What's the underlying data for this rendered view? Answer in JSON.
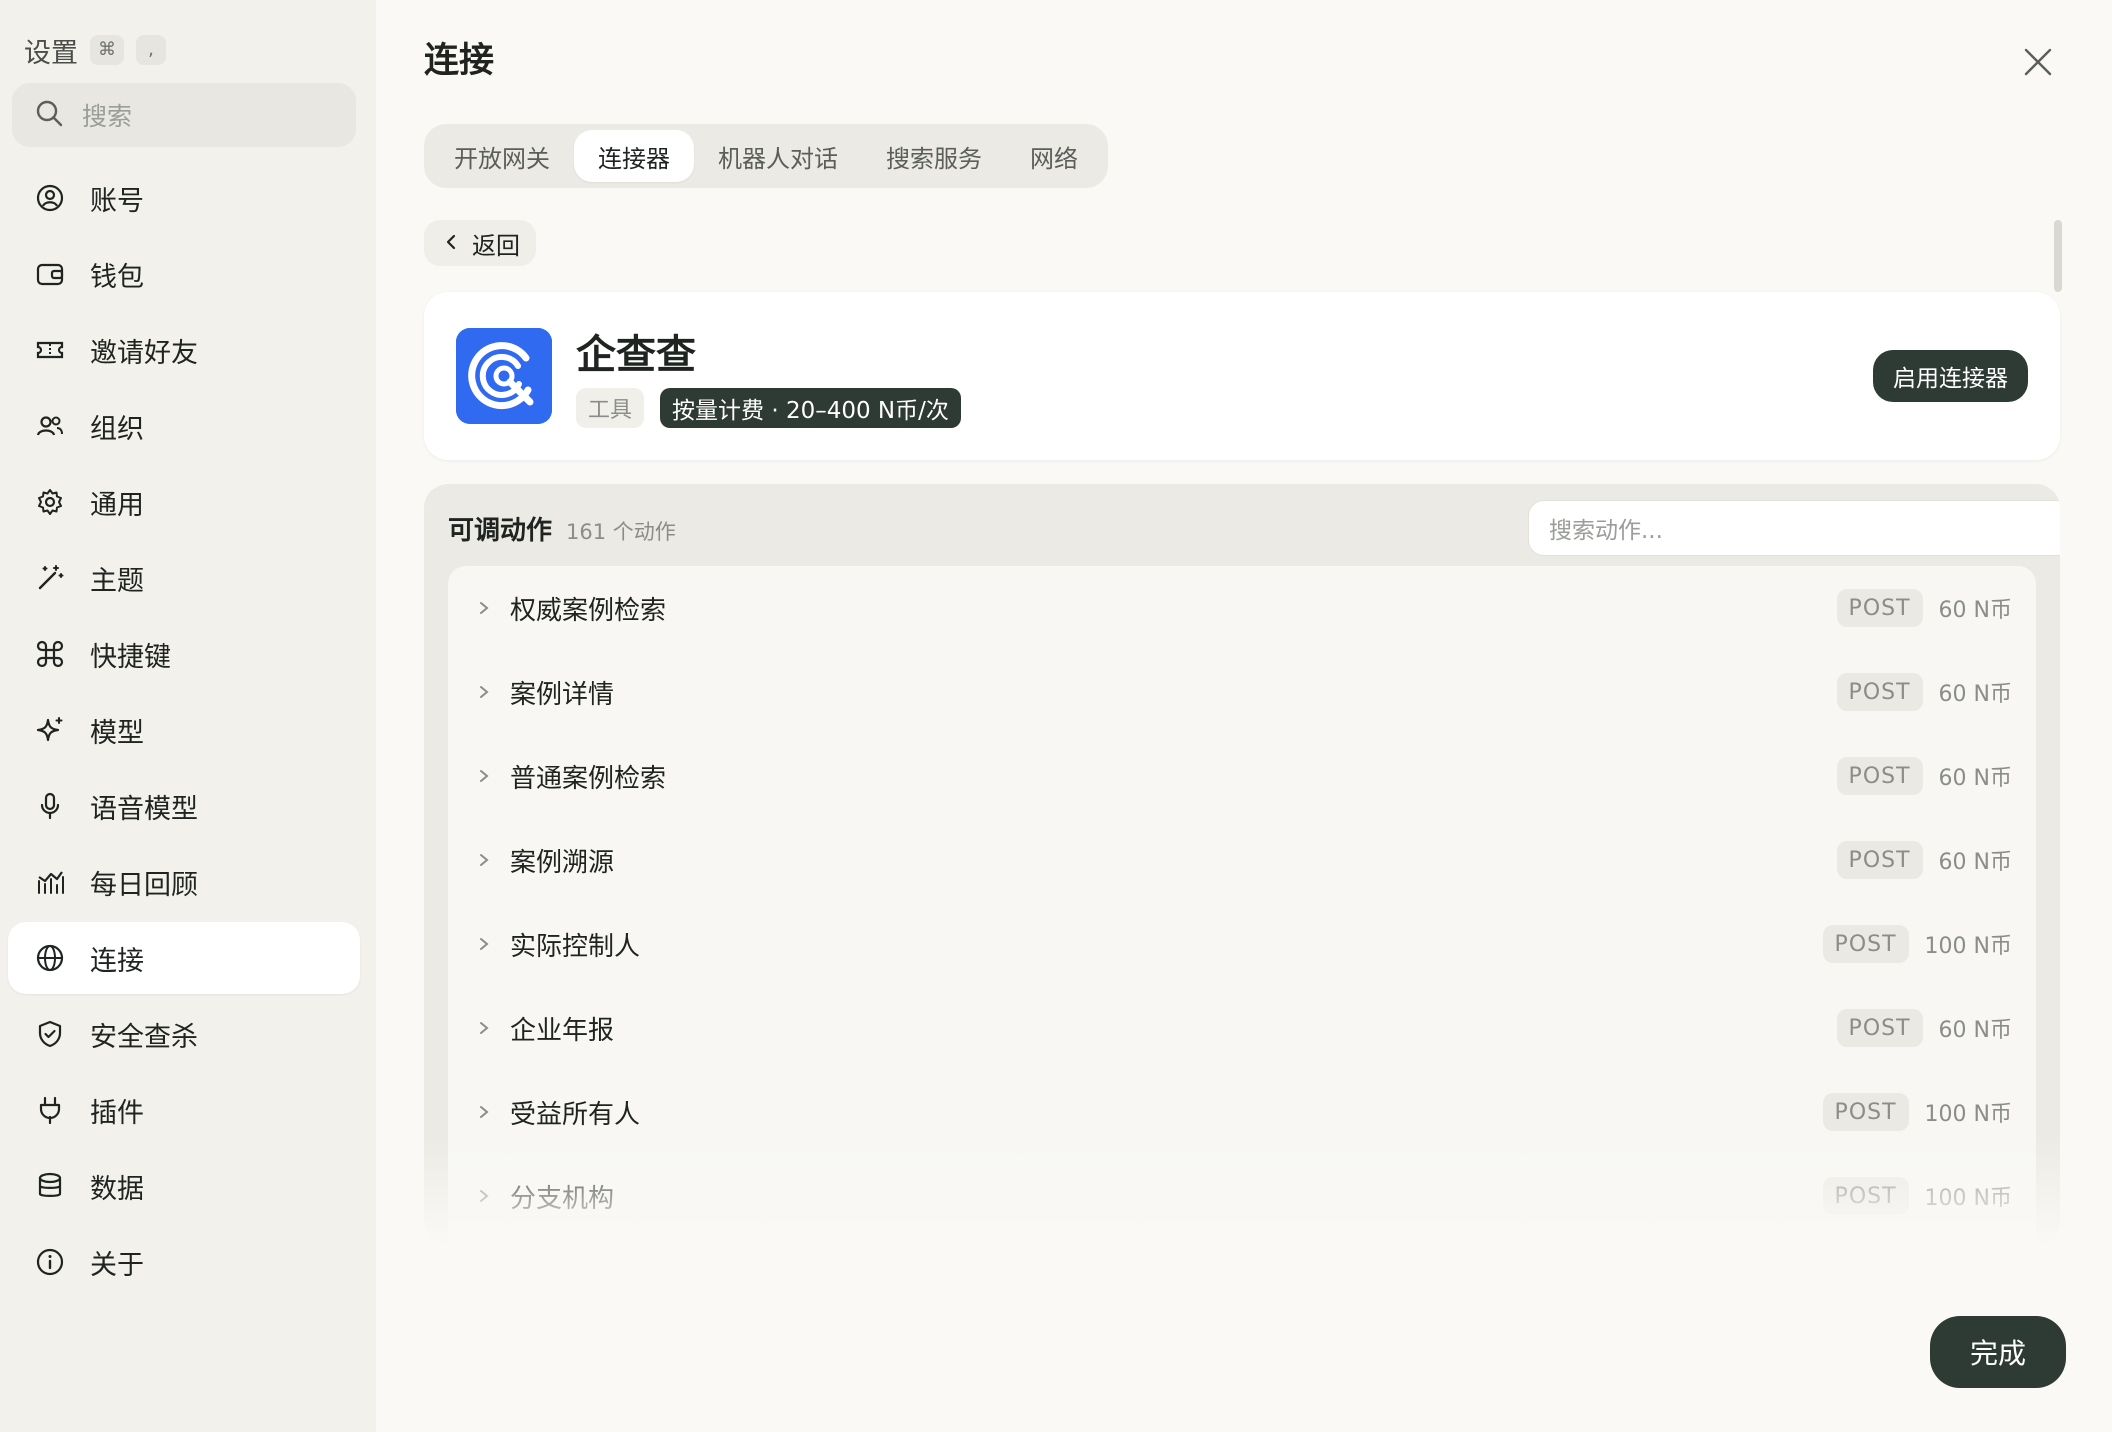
{
  "sidebar": {
    "title": "设置",
    "shortcut": [
      "⌘",
      ","
    ],
    "search_placeholder": "搜索",
    "items": [
      {
        "label": "账号",
        "icon": "user-circle-icon"
      },
      {
        "label": "钱包",
        "icon": "wallet-icon"
      },
      {
        "label": "邀请好友",
        "icon": "ticket-icon"
      },
      {
        "label": "组织",
        "icon": "users-icon"
      },
      {
        "label": "通用",
        "icon": "gear-icon"
      },
      {
        "label": "主题",
        "icon": "magic-wand-icon"
      },
      {
        "label": "快捷键",
        "icon": "command-icon"
      },
      {
        "label": "模型",
        "icon": "sparkle-icon"
      },
      {
        "label": "语音模型",
        "icon": "microphone-icon"
      },
      {
        "label": "每日回顾",
        "icon": "chart-icon"
      },
      {
        "label": "连接",
        "icon": "globe-icon",
        "active": true
      },
      {
        "label": "安全查杀",
        "icon": "shield-check-icon"
      },
      {
        "label": "插件",
        "icon": "plug-icon"
      },
      {
        "label": "数据",
        "icon": "database-icon"
      },
      {
        "label": "关于",
        "icon": "info-icon"
      }
    ]
  },
  "main": {
    "title": "连接",
    "tabs": [
      {
        "label": "开放网关"
      },
      {
        "label": "连接器",
        "active": true
      },
      {
        "label": "机器人对话"
      },
      {
        "label": "搜索服务"
      },
      {
        "label": "网络"
      }
    ],
    "back_label": "返回",
    "connector": {
      "name": "企查查",
      "category_tag": "工具",
      "pricing_tag": "按量计费 · 20–400 N币/次",
      "enable_label": "启用连接器",
      "logo_color": "#2f6af0"
    },
    "actions": {
      "title": "可调动作",
      "count": "161 个动作",
      "search_placeholder": "搜索动作...",
      "rows": [
        {
          "name": "权威案例检索",
          "method": "POST",
          "price": "60 N币"
        },
        {
          "name": "案例详情",
          "method": "POST",
          "price": "60 N币"
        },
        {
          "name": "普通案例检索",
          "method": "POST",
          "price": "60 N币"
        },
        {
          "name": "案例溯源",
          "method": "POST",
          "price": "60 N币"
        },
        {
          "name": "实际控制人",
          "method": "POST",
          "price": "100 N币"
        },
        {
          "name": "企业年报",
          "method": "POST",
          "price": "60 N币"
        },
        {
          "name": "受益所有人",
          "method": "POST",
          "price": "100 N币"
        },
        {
          "name": "分支机构",
          "method": "POST",
          "price": "100 N币"
        }
      ]
    },
    "done_label": "完成"
  },
  "colors": {
    "accent_dark": "#2e3a34",
    "sidebar_bg": "#f2f1ec",
    "page_bg": "#faf9f6"
  }
}
